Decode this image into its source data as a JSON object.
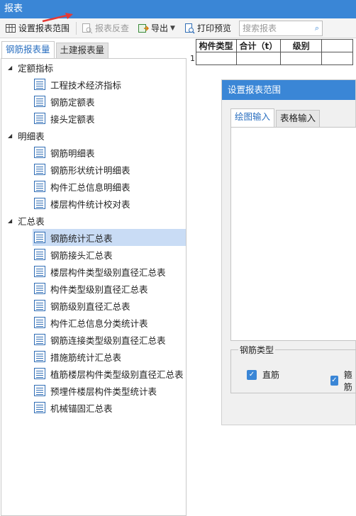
{
  "window": {
    "title": "报表"
  },
  "toolbar": {
    "set_range": "设置报表范围",
    "reverse_check": "报表反查",
    "export": "导出",
    "print_preview": "打印预览",
    "search_placeholder": "搜索报表"
  },
  "left_tabs": [
    "钢筋报表量",
    "土建报表量"
  ],
  "tree": {
    "groups": [
      {
        "label": "定额指标",
        "items": [
          "工程技术经济指标",
          "钢筋定额表",
          "接头定额表"
        ]
      },
      {
        "label": "明细表",
        "items": [
          "钢筋明细表",
          "钢筋形状统计明细表",
          "构件汇总信息明细表",
          "楼层构件统计校对表"
        ]
      },
      {
        "label": "汇总表",
        "items": [
          "钢筋统计汇总表",
          "钢筋接头汇总表",
          "楼层构件类型级别直径汇总表",
          "构件类型级别直径汇总表",
          "钢筋级别直径汇总表",
          "构件汇总信息分类统计表",
          "钢筋连接类型级别直径汇总表",
          "措施筋统计汇总表",
          "植筋楼层构件类型级别直径汇总表",
          "预埋件楼层构件类型统计表",
          "机械锚固汇总表"
        ]
      }
    ],
    "selected": "钢筋统计汇总表"
  },
  "grid": {
    "columns": [
      "构件类型",
      "合计（t）",
      "级别",
      ""
    ],
    "row_number": "1"
  },
  "dialog": {
    "title": "设置报表范围",
    "tabs": [
      "绘图输入",
      "表格输入"
    ],
    "steel_type_legend": "钢筋类型",
    "checkbox_1": "直筋",
    "checkbox_2": "箍筋"
  },
  "colors": {
    "accent": "#3a86d6",
    "selected_row": "#c9dcf5",
    "annotation_arrow": "#e53935"
  }
}
